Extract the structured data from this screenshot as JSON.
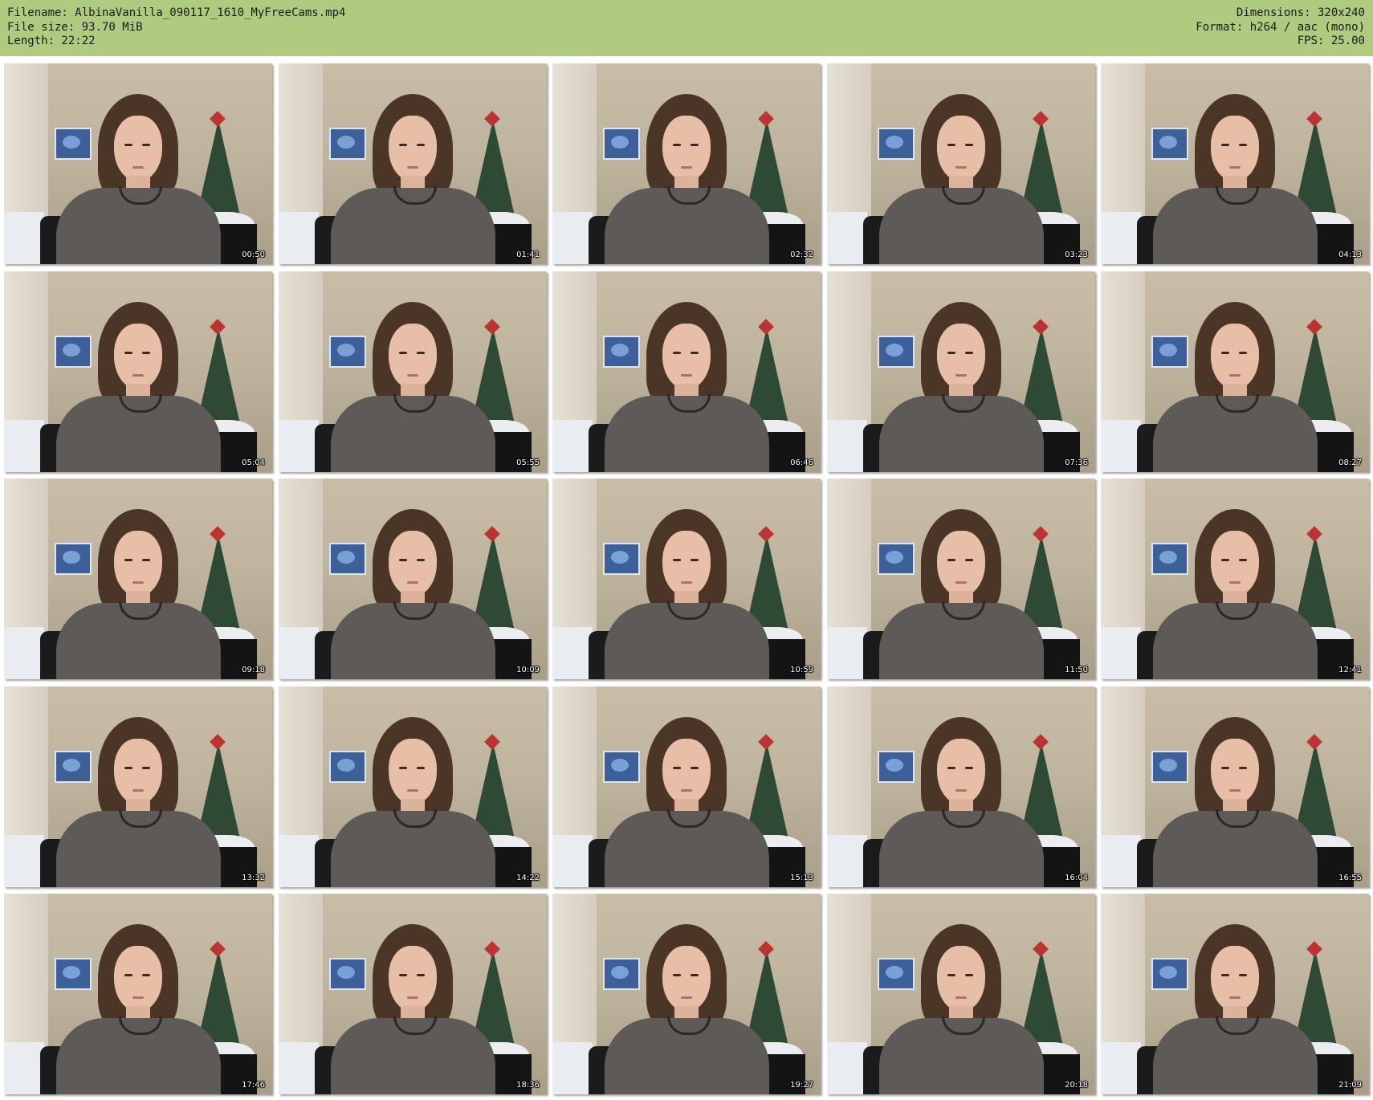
{
  "header": {
    "filename_line": "Filename: AlbinaVanilla_090117_1610_MyFreeCams.mp4",
    "filesize_line": "File size: 93.70 MiB",
    "length_line": "Length: 22:22",
    "dimensions_line": "Dimensions: 320x240",
    "format_line": "Format: h264 / aac (mono)",
    "fps_line": "FPS: 25.00"
  },
  "colors": {
    "header_bg": "#aecb7f",
    "page_bg": "#ffffff"
  },
  "thumbnails": [
    {
      "timestamp": "00:50"
    },
    {
      "timestamp": "01:41"
    },
    {
      "timestamp": "02:32"
    },
    {
      "timestamp": "03:23"
    },
    {
      "timestamp": "04:13"
    },
    {
      "timestamp": "05:04"
    },
    {
      "timestamp": "05:55"
    },
    {
      "timestamp": "06:46"
    },
    {
      "timestamp": "07:36"
    },
    {
      "timestamp": "08:27"
    },
    {
      "timestamp": "09:18"
    },
    {
      "timestamp": "10:09"
    },
    {
      "timestamp": "10:59"
    },
    {
      "timestamp": "11:50"
    },
    {
      "timestamp": "12:41"
    },
    {
      "timestamp": "13:32"
    },
    {
      "timestamp": "14:22"
    },
    {
      "timestamp": "15:13"
    },
    {
      "timestamp": "16:04"
    },
    {
      "timestamp": "16:55"
    },
    {
      "timestamp": "17:46"
    },
    {
      "timestamp": "18:36"
    },
    {
      "timestamp": "19:27"
    },
    {
      "timestamp": "20:18"
    },
    {
      "timestamp": "21:09"
    }
  ]
}
